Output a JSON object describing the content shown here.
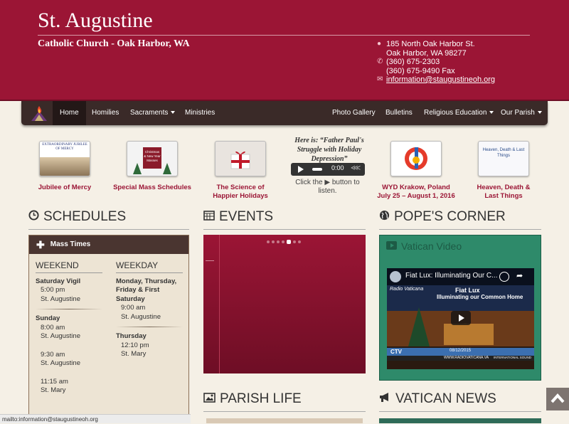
{
  "header": {
    "title": "St. Augustine",
    "subtitle": "Catholic Church - Oak Harbor, WA",
    "address_line1": "185 North Oak Harbor St.",
    "address_line2": "Oak Harbor, WA 98277",
    "phone": "(360) 675-2303",
    "fax": "(360) 675-9490 Fax",
    "email": "information@staugustineoh.org"
  },
  "nav": {
    "items": [
      "Home",
      "Homilies",
      "Sacraments",
      "Ministries",
      "Photo Gallery",
      "Bulletins",
      "Religious Education",
      "Our Parish"
    ]
  },
  "features": {
    "items": [
      {
        "caption": "Jubilee of Mercy",
        "thumb_text": "EXTRAORDINARY JUBILEE OF MERCY"
      },
      {
        "caption": "Special Mass Schedules",
        "thumb_text": "Christmas & New Year Masses"
      },
      {
        "caption_line1": "The Science of",
        "caption_line2": "Happier Holidays"
      },
      {
        "caption_line1": "WYD Krakow, Poland",
        "caption_line2": "July 25 – August 1, 2016"
      },
      {
        "caption_line1": "Heaven, Death &",
        "caption_line2": "Last Things",
        "thumb_text": "Heaven, Death & Last Things"
      }
    ]
  },
  "audio": {
    "title_line1": "Here is: “Father Paul's",
    "title_line2": "Struggle with Holiday",
    "title_line3": "Depression”",
    "time": "0:00",
    "help_line1": "Click the ▶ button to",
    "help_line2": "listen."
  },
  "sections": {
    "schedules": "SCHEDULES",
    "events": "EVENTS",
    "popes_corner": "POPE'S CORNER",
    "parish_life": "PARISH LIFE",
    "vatican_news": "VATICAN NEWS"
  },
  "schedule": {
    "bar_label": "Mass Times",
    "weekend": {
      "heading": "WEEKEND",
      "vigil_label": "Saturday Vigil",
      "vigil_time": "5:00 pm",
      "vigil_place": "St. Augustine",
      "sunday_label": "Sunday",
      "sun1_time": "8:00 am",
      "sun1_place": "St. Augustine",
      "sun2_time": "9:30 am",
      "sun2_place": "St. Augustine",
      "sun3_time": "11:15 am",
      "sun3_place": "St. Mary"
    },
    "weekday": {
      "heading": "WEEKDAY",
      "days_line1": "Monday, Thursday,",
      "days_line2": "Friday & First",
      "days_line3": "Saturday",
      "days_time": "9:00 am",
      "days_place": "St. Augustine",
      "thursday_label": "Thursday",
      "thu_time": "12:10 pm",
      "thu_place": "St. Mary"
    }
  },
  "pope": {
    "video_heading": "Vatican Video",
    "video_title": "Fiat Lux: Illuminating Our C...",
    "video_overlay_title": "Fiat Lux",
    "video_overlay_sub": "Illuminating our Common Home",
    "video_brand": "Radio Vaticana",
    "video_date": "08/12/2015",
    "video_url": "WWW.RADIOVATICANA.VA",
    "video_service": "INTERNATIONAL SOUND",
    "video_channel": "CTV"
  },
  "status_bar": "mailto:information@staugustineoh.org",
  "colors": {
    "brand": "#9b1535",
    "nav": "#3a2a28",
    "pope_box": "#2e8a6a",
    "page_bg": "#f5f0e6"
  }
}
